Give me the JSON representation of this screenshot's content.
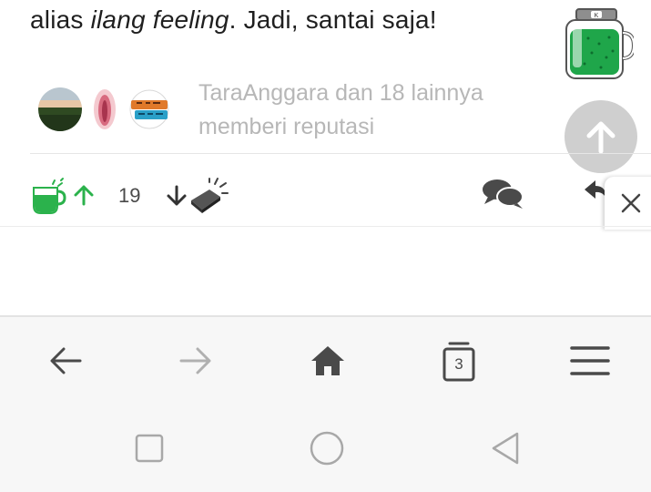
{
  "post": {
    "text_prefix": "alias ",
    "text_italic": "ilang feeling",
    "text_suffix": ". Jadi, santai saja!"
  },
  "reputation": {
    "line1": "TaraAnggara dan 18 lainnya",
    "line2": "memberi reputasi"
  },
  "actions": {
    "vote_count": "19"
  },
  "browser_nav": {
    "tab_count": "3"
  },
  "colors": {
    "accent_green": "#2bb24c",
    "muted_text": "#b7b7b7",
    "scroll_button_bg": "#cfcfcf",
    "icon_dark": "#4a4a4a"
  },
  "icons": {
    "jar": "kaskus-jar-icon",
    "scroll_up": "arrow-up-icon",
    "cendol": "cendol-cup-icon",
    "upvote": "arrow-up-green-icon",
    "downvote": "arrow-down-icon",
    "bata": "brick-icon",
    "comment": "chat-bubbles-icon",
    "share": "share-arrow-icon",
    "close": "close-icon",
    "back": "arrow-left-icon",
    "forward": "arrow-right-icon",
    "home": "home-icon",
    "tabs": "tabs-icon",
    "menu": "hamburger-menu-icon",
    "recents": "square-icon",
    "sys_home": "circle-icon",
    "sys_back": "triangle-back-icon"
  }
}
